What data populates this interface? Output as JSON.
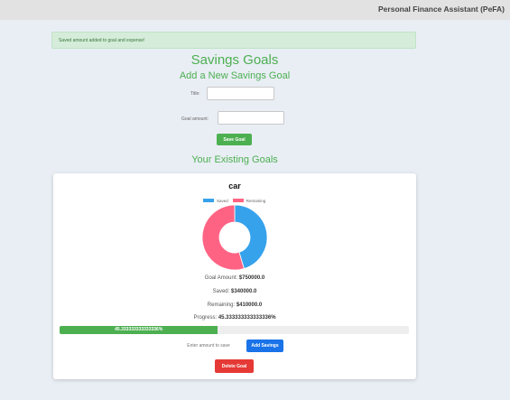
{
  "header": {
    "app_title": "Personal Finance Assistant (PeFA)"
  },
  "alert": {
    "message": "Saved amount added to goal and expense!"
  },
  "page": {
    "title": "Savings Goals",
    "add_goal_heading": "Add a New Savings Goal",
    "existing_goals_heading": "Your Existing Goals"
  },
  "form": {
    "title_label": "Title:",
    "title_value": "",
    "amount_label": "Goal amount:",
    "amount_value": "",
    "save_button": "Save Goal"
  },
  "goal": {
    "title": "car",
    "legend": [
      {
        "label": "Saved",
        "color": "#36a2eb"
      },
      {
        "label": "Remaining",
        "color": "#ff6384"
      }
    ],
    "chart_data": {
      "type": "pie",
      "labels": [
        "Saved",
        "Remaining"
      ],
      "values": [
        340000,
        410000
      ],
      "colors": [
        "#36a2eb",
        "#ff6384"
      ]
    },
    "goal_amount_label": "Goal Amount:",
    "goal_amount_value": "$750000.0",
    "saved_label": "Saved:",
    "saved_value": "$340000.0",
    "remaining_label": "Remaining:",
    "remaining_value": "$410000.0",
    "progress_label": "Progress:",
    "progress_value": "45.333333333333336%",
    "progress_fraction": 0.4533,
    "progress_bar_text": "45.333333333333336%",
    "amount_placeholder": "Enter amount to save",
    "add_savings_button": "Add Savings",
    "delete_button": "Delete Goal"
  },
  "colors": {
    "accent_green": "#4caf50",
    "button_blue": "#1a73e8",
    "button_red": "#e53935"
  }
}
